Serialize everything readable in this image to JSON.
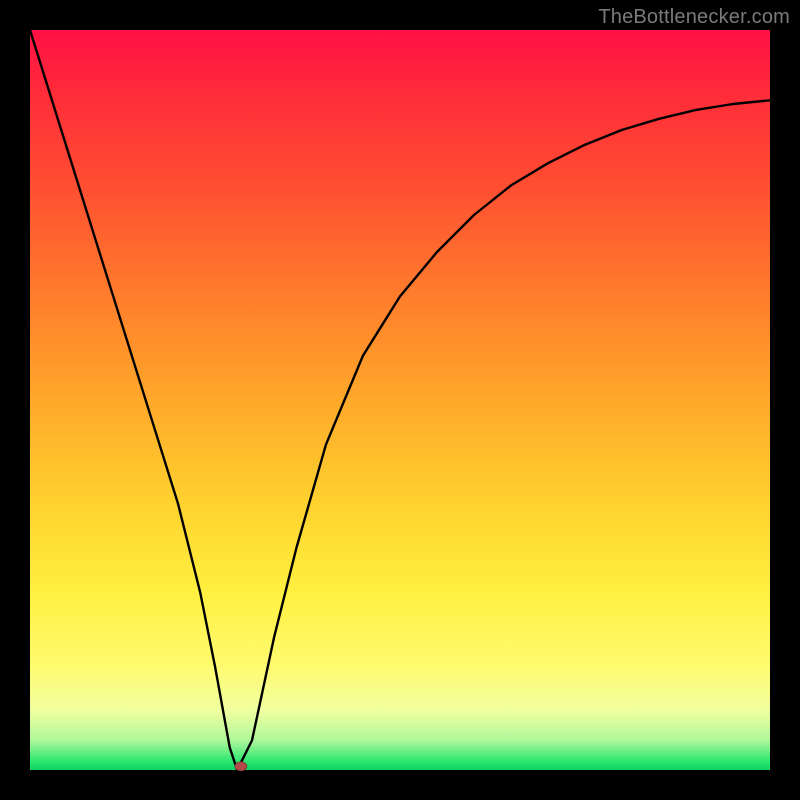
{
  "watermark": "TheBottlenecker.com",
  "colors": {
    "background": "#000000",
    "curve": "#000000",
    "marker": "#b44b4b",
    "gradient_top": "#ff1044",
    "gradient_bottom": "#0ed061"
  },
  "chart_data": {
    "type": "line",
    "title": "",
    "xlabel": "",
    "ylabel": "",
    "xlim": [
      0,
      100
    ],
    "ylim": [
      0,
      100
    ],
    "series": [
      {
        "name": "bottleneck-curve",
        "x": [
          0,
          5,
          10,
          15,
          20,
          23,
          25,
          27,
          28,
          30,
          33,
          36,
          40,
          45,
          50,
          55,
          60,
          65,
          70,
          75,
          80,
          85,
          90,
          95,
          100
        ],
        "values": [
          100,
          84,
          68,
          52,
          36,
          24,
          14,
          3,
          0,
          4,
          18,
          30,
          44,
          56,
          64,
          70,
          75,
          79,
          82,
          84.5,
          86.5,
          88,
          89.2,
          90,
          90.5
        ]
      }
    ],
    "marker": {
      "x": 28.5,
      "y": 0.5
    },
    "annotations": [],
    "legend": {
      "visible": false
    },
    "grid": false
  }
}
